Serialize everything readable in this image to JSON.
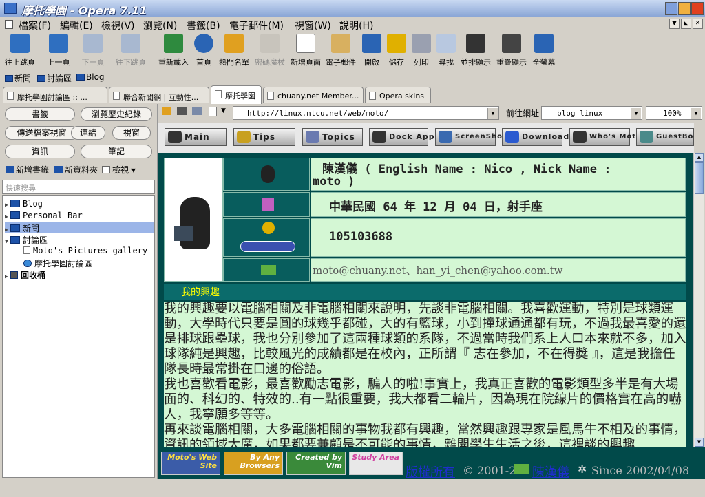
{
  "window": {
    "title": "摩托學園 - Opera 7.11"
  },
  "menu": [
    "檔案(F)",
    "編輯(E)",
    "檢視(V)",
    "瀏覽(N)",
    "書籤(B)",
    "電子郵件(M)",
    "視窗(W)",
    "說明(H)"
  ],
  "toolbar": [
    "往上跳頁",
    "上一頁",
    "下一頁",
    "往下跳頁",
    "重新載入",
    "首頁",
    "熱門名單",
    "密碼魔杖",
    "新增頁面",
    "電子郵件",
    "開啟",
    "儲存",
    "列印",
    "尋找",
    "並排顯示",
    "重疊顯示",
    "全螢幕"
  ],
  "bookmarks": [
    "新聞",
    "討論區",
    "Blog"
  ],
  "tabs": [
    "摩托學園討論區 :: ...",
    "聯合新聞網 | 互動性...",
    "摩托學園",
    "chuany.net Member...",
    "Opera skins"
  ],
  "panel": {
    "buttons": [
      "書籤",
      "瀏覽歷史紀錄",
      "傳送檔案視窗",
      "連結",
      "視窗",
      "資訊",
      "筆記"
    ],
    "tools": [
      "新增書籤",
      "新資料夾",
      "檢視"
    ],
    "search_placeholder": "快速搜尋",
    "tree": [
      "Blog",
      "Personal Bar",
      "新聞",
      "討論區",
      "Moto's Pictures gallery",
      "摩托學園討論區",
      "回收桶"
    ]
  },
  "address": {
    "url": "http://linux.ntcu.net/web/moto/",
    "goto_label": "前往網址",
    "search": "blog linux",
    "zoom": "100%"
  },
  "site_nav": [
    "Main",
    "Tips",
    "Topics",
    "Dock Apps",
    "ScreenShot",
    "Download",
    "Who's Moto",
    "GuestBook"
  ],
  "profile": {
    "name_line1": "陳漢儀 ( English Name : Nico , Nick Name :",
    "name_line2": "moto )",
    "birth": "中華民國 64 年 12 月 04 日，射手座",
    "icq": "105103688",
    "email": "moto@chuany.net、han_yi_chen@yahoo.com.tw"
  },
  "section_title": "我的興趣",
  "paragraphs": [
    "我的興趣要以電腦相關及非電腦相關來說明，先談非電腦相關。我喜歡運動，特別是球類運動，大學時代只要是圓的球幾乎都碰，大的有籃球，小到撞球通通都有玩，不過我最喜愛的還是排球跟壘球，我也分別參加了這兩種球類的系隊，不過當時我們系上人口本來就不多，加入球隊純是興趣，比較風光的成績都是在校內，正所謂『 志在參加，不在得獎 』，這是我擔任隊長時最常掛在口邊的俗語。",
    "我也喜歡看電影，最喜歡勵志電影，騙人的啦!事實上，我真正喜歡的電影類型多半是有大場面的、科幻的、特效的..有一點很重要，我大都看二輪片，因為現在院線片的價格實在高的嚇人，我寧願多等等。",
    "再來談電腦相關，大多電腦相關的事物我都有興趣，當然興趣跟專家是風馬牛不相及的事情，資訊的領域太廣，如果都要兼顧是不可能的事情，離開學生生活之後，這裡談的興趣"
  ],
  "footer": {
    "badges": [
      "Moto's Web Site",
      "By Any Browsers",
      "Created by Vim",
      "Study Area"
    ],
    "copyright_link": "版權所有",
    "copyright_text": "© 2001-2",
    "author_link": "陳漢儀",
    "since": "Since 2002/04/08"
  }
}
